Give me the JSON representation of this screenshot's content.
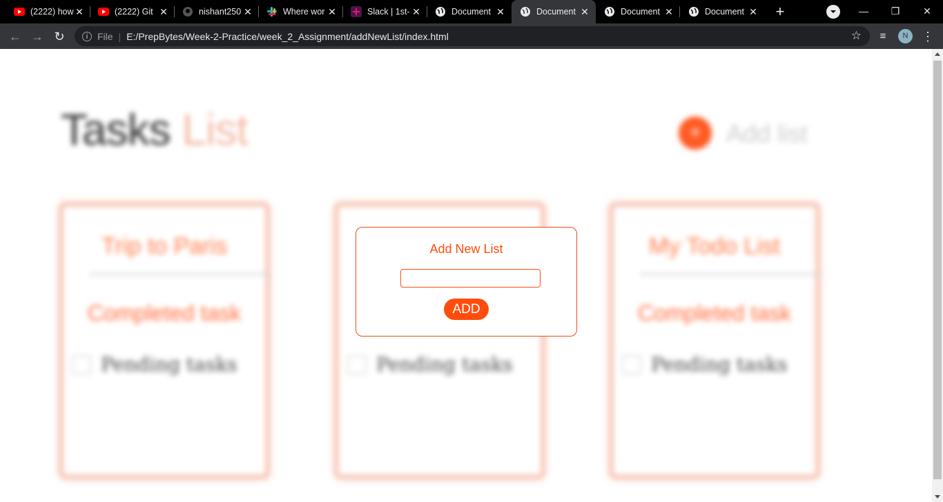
{
  "browser": {
    "tabs": [
      {
        "title": "(2222) how",
        "icon": "youtube-icon",
        "active": false
      },
      {
        "title": "(2222) Git",
        "icon": "youtube-icon",
        "active": false
      },
      {
        "title": "nishant250",
        "icon": "github-icon",
        "active": false
      },
      {
        "title": "Where wor",
        "icon": "slack-icon",
        "active": false
      },
      {
        "title": "Slack | 1st-",
        "icon": "slack-icon",
        "active": false
      },
      {
        "title": "Document",
        "icon": "globe-icon",
        "active": false
      },
      {
        "title": "Document",
        "icon": "globe-icon",
        "active": true
      },
      {
        "title": "Document",
        "icon": "globe-icon",
        "active": false
      },
      {
        "title": "Document",
        "icon": "globe-icon",
        "active": false
      }
    ],
    "address": {
      "scheme_label": "File",
      "url": "E:/PrepBytes/Week-2-Practice/week_2_Assignment/addNewList/index.html"
    },
    "profile_initial": "N"
  },
  "page": {
    "heading_main": "Tasks",
    "heading_accent": "List",
    "add_button_symbol": "+",
    "add_label": "Add list",
    "cards": [
      {
        "title": "Trip to Paris",
        "completed_label": "Completed task",
        "pending_label": "Pending tasks"
      },
      {
        "title": "",
        "completed_label": "",
        "pending_label": "Pending tasks"
      },
      {
        "title": "My Todo List",
        "completed_label": "Completed task",
        "pending_label": "Pending tasks"
      }
    ]
  },
  "modal": {
    "title": "Add New List",
    "input_value": "",
    "button_label": "ADD"
  },
  "colors": {
    "accent": "#ff4d0d",
    "tab_strip": "#000000",
    "toolbar": "#35363a"
  }
}
